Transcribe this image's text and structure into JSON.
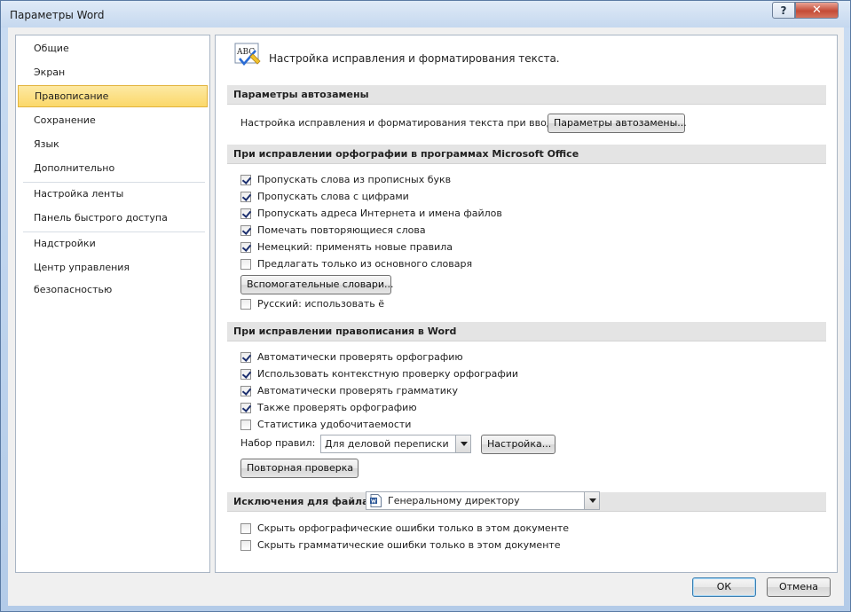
{
  "window": {
    "title": "Параметры Word",
    "help_label": "?",
    "close_label": "✕"
  },
  "sidebar": {
    "items": [
      {
        "label": "Общие"
      },
      {
        "label": "Экран"
      },
      {
        "label": "Правописание",
        "selected": true
      },
      {
        "label": "Сохранение"
      },
      {
        "label": "Язык"
      },
      {
        "label": "Дополнительно"
      },
      {
        "label": "Настройка ленты"
      },
      {
        "label": "Панель быстрого доступа"
      },
      {
        "label": "Надстройки"
      },
      {
        "label": "Центр управления безопасностью"
      }
    ]
  },
  "header": {
    "icon": "abc-spellcheck-icon",
    "icon_text": "ABC",
    "text": "Настройка исправления и форматирования текста."
  },
  "autocorrect": {
    "section_title": "Параметры автозамены",
    "label": "Настройка исправления и форматирования текста при вводе:",
    "button_label": "Параметры автозамены..."
  },
  "office_spelling": {
    "section_title": "При исправлении орфографии в программах Microsoft Office",
    "options": [
      {
        "label": "Пропускать слова из прописных букв",
        "checked": true
      },
      {
        "label": "Пропускать слова с цифрами",
        "checked": true
      },
      {
        "label": "Пропускать адреса Интернета и имена файлов",
        "checked": true
      },
      {
        "label": "Помечать повторяющиеся слова",
        "checked": true
      },
      {
        "label": "Немецкий: применять новые правила",
        "checked": true
      },
      {
        "label": "Предлагать только из основного словаря",
        "checked": false
      }
    ],
    "dictionaries_button": "Вспомогательные словари...",
    "russian_option": {
      "label": "Русский: использовать ё",
      "checked": false
    }
  },
  "word_spelling": {
    "section_title": "При исправлении правописания в Word",
    "options": [
      {
        "label": "Автоматически проверять орфографию",
        "checked": true
      },
      {
        "label": "Использовать контекстную проверку орфографии",
        "checked": true
      },
      {
        "label": "Автоматически проверять грамматику",
        "checked": true
      },
      {
        "label": "Также проверять орфографию",
        "checked": true
      },
      {
        "label": "Статистика удобочитаемости",
        "checked": false
      }
    ],
    "rules_label": "Набор правил:",
    "rules_value": "Для деловой переписки",
    "settings_button": "Настройка...",
    "recheck_button": "Повторная проверка"
  },
  "exceptions": {
    "label": "Исключения для файла:",
    "file_value": "Генеральному директору",
    "options": [
      {
        "label": "Скрыть орфографические ошибки только в этом документе",
        "checked": false
      },
      {
        "label": "Скрыть грамматические ошибки только в этом документе",
        "checked": false
      }
    ]
  },
  "footer": {
    "ok_label": "ОК",
    "cancel_label": "Отмена"
  },
  "colors": {
    "selection": "#fbd86a",
    "section_bg": "#e4e4e4",
    "check": "#1c2f6e"
  }
}
